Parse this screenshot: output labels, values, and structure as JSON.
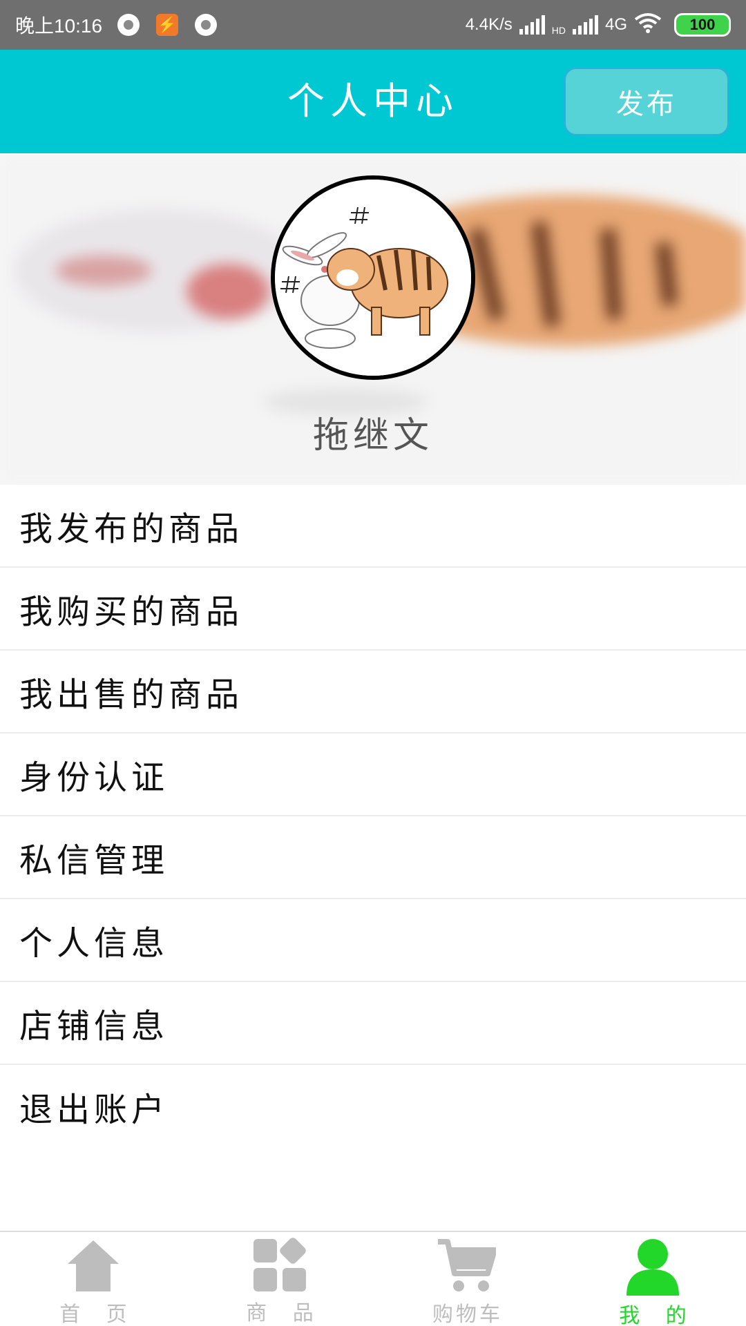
{
  "status_bar": {
    "time": "晚上10:16",
    "net_speed": "4.4K/s",
    "network_label": "4G",
    "hd_label": "HD",
    "battery": "100"
  },
  "header": {
    "title": "个人中心",
    "publish_label": "发布",
    "accent_color": "#00c8d2"
  },
  "profile": {
    "username": "拖继文",
    "avatar_icon": "tiger-rabbit-avatar"
  },
  "menu": {
    "items": [
      {
        "label": "我发布的商品"
      },
      {
        "label": "我购买的商品"
      },
      {
        "label": "我出售的商品"
      },
      {
        "label": "身份认证"
      },
      {
        "label": "私信管理"
      },
      {
        "label": "个人信息"
      },
      {
        "label": "店铺信息"
      },
      {
        "label": "退出账户"
      }
    ]
  },
  "bottom_nav": {
    "active_color": "#22d62a",
    "inactive_color": "#bdbdbd",
    "items": [
      {
        "label": "首 页",
        "icon": "home-icon"
      },
      {
        "label": "商 品",
        "icon": "grid-icon"
      },
      {
        "label": "购物车",
        "icon": "cart-icon"
      },
      {
        "label": "我 的",
        "icon": "user-icon",
        "active": true
      }
    ]
  }
}
